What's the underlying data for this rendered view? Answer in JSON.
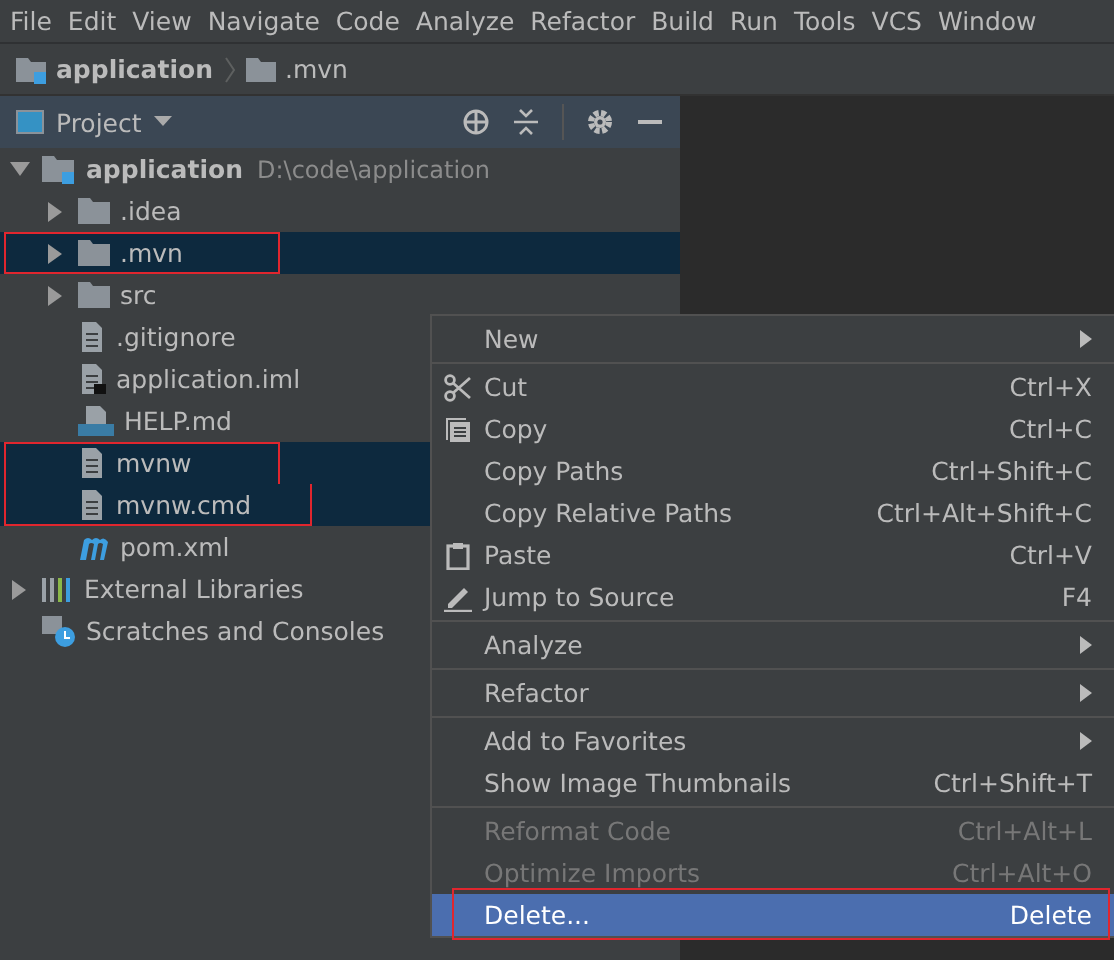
{
  "menu_bar": [
    "File",
    "Edit",
    "View",
    "Navigate",
    "Code",
    "Analyze",
    "Refactor",
    "Build",
    "Run",
    "Tools",
    "VCS",
    "Window"
  ],
  "breadcrumb": [
    {
      "label": "application",
      "kind": "module"
    },
    {
      "label": ".mvn",
      "kind": "folder"
    }
  ],
  "project_panel": {
    "title": "Project"
  },
  "tree": [
    {
      "label": "application",
      "hint": "D:\\code\\application",
      "kind": "module",
      "expanded": true,
      "selected": false,
      "marked": false,
      "children": [
        {
          "label": ".idea",
          "kind": "folder",
          "expanded": false,
          "selected": false,
          "marked": false
        },
        {
          "label": ".mvn",
          "kind": "folder",
          "expanded": false,
          "selected": true,
          "marked": true
        },
        {
          "label": "src",
          "kind": "folder",
          "expanded": false,
          "selected": false,
          "marked": false
        },
        {
          "label": ".gitignore",
          "kind": "file",
          "selected": false,
          "marked": false
        },
        {
          "label": "application.iml",
          "kind": "iml",
          "selected": false,
          "marked": false
        },
        {
          "label": "HELP.md",
          "kind": "markdown",
          "selected": false,
          "marked": false
        },
        {
          "label": "mvnw",
          "kind": "file",
          "selected": true,
          "marked": true
        },
        {
          "label": "mvnw.cmd",
          "kind": "file",
          "selected": true,
          "marked": true
        },
        {
          "label": "pom.xml",
          "kind": "maven",
          "selected": false,
          "marked": false
        }
      ]
    },
    {
      "label": "External Libraries",
      "kind": "libraries",
      "expanded": false,
      "selected": false,
      "marked": false
    },
    {
      "label": "Scratches and Consoles",
      "kind": "scratches",
      "selected": false,
      "marked": false
    }
  ],
  "context_menu": [
    {
      "kind": "submenu",
      "label": "New",
      "disabled": false,
      "selected": false,
      "marked": false
    },
    {
      "kind": "separator"
    },
    {
      "kind": "item",
      "label": "Cut",
      "shortcut": "Ctrl+X",
      "disabled": false,
      "selected": false,
      "marked": false
    },
    {
      "kind": "item",
      "label": "Copy",
      "shortcut": "Ctrl+C",
      "disabled": false,
      "selected": false,
      "marked": false
    },
    {
      "kind": "item",
      "label": "Copy Paths",
      "shortcut": "Ctrl+Shift+C",
      "disabled": false,
      "selected": false,
      "marked": false
    },
    {
      "kind": "item",
      "label": "Copy Relative Paths",
      "shortcut": "Ctrl+Alt+Shift+C",
      "disabled": false,
      "selected": false,
      "marked": false
    },
    {
      "kind": "item",
      "label": "Paste",
      "shortcut": "Ctrl+V",
      "disabled": false,
      "selected": false,
      "marked": false
    },
    {
      "kind": "item",
      "label": "Jump to Source",
      "shortcut": "F4",
      "disabled": false,
      "selected": false,
      "marked": false
    },
    {
      "kind": "separator"
    },
    {
      "kind": "submenu",
      "label": "Analyze",
      "disabled": false,
      "selected": false,
      "marked": false
    },
    {
      "kind": "separator"
    },
    {
      "kind": "submenu",
      "label": "Refactor",
      "disabled": false,
      "selected": false,
      "marked": false
    },
    {
      "kind": "separator"
    },
    {
      "kind": "submenu",
      "label": "Add to Favorites",
      "disabled": false,
      "selected": false,
      "marked": false
    },
    {
      "kind": "item",
      "label": "Show Image Thumbnails",
      "shortcut": "Ctrl+Shift+T",
      "disabled": false,
      "selected": false,
      "marked": false
    },
    {
      "kind": "separator"
    },
    {
      "kind": "item",
      "label": "Reformat Code",
      "shortcut": "Ctrl+Alt+L",
      "disabled": true,
      "selected": false,
      "marked": false
    },
    {
      "kind": "item",
      "label": "Optimize Imports",
      "shortcut": "Ctrl+Alt+O",
      "disabled": true,
      "selected": false,
      "marked": false
    },
    {
      "kind": "item",
      "label": "Delete...",
      "shortcut": "Delete",
      "disabled": false,
      "selected": true,
      "marked": true
    }
  ]
}
